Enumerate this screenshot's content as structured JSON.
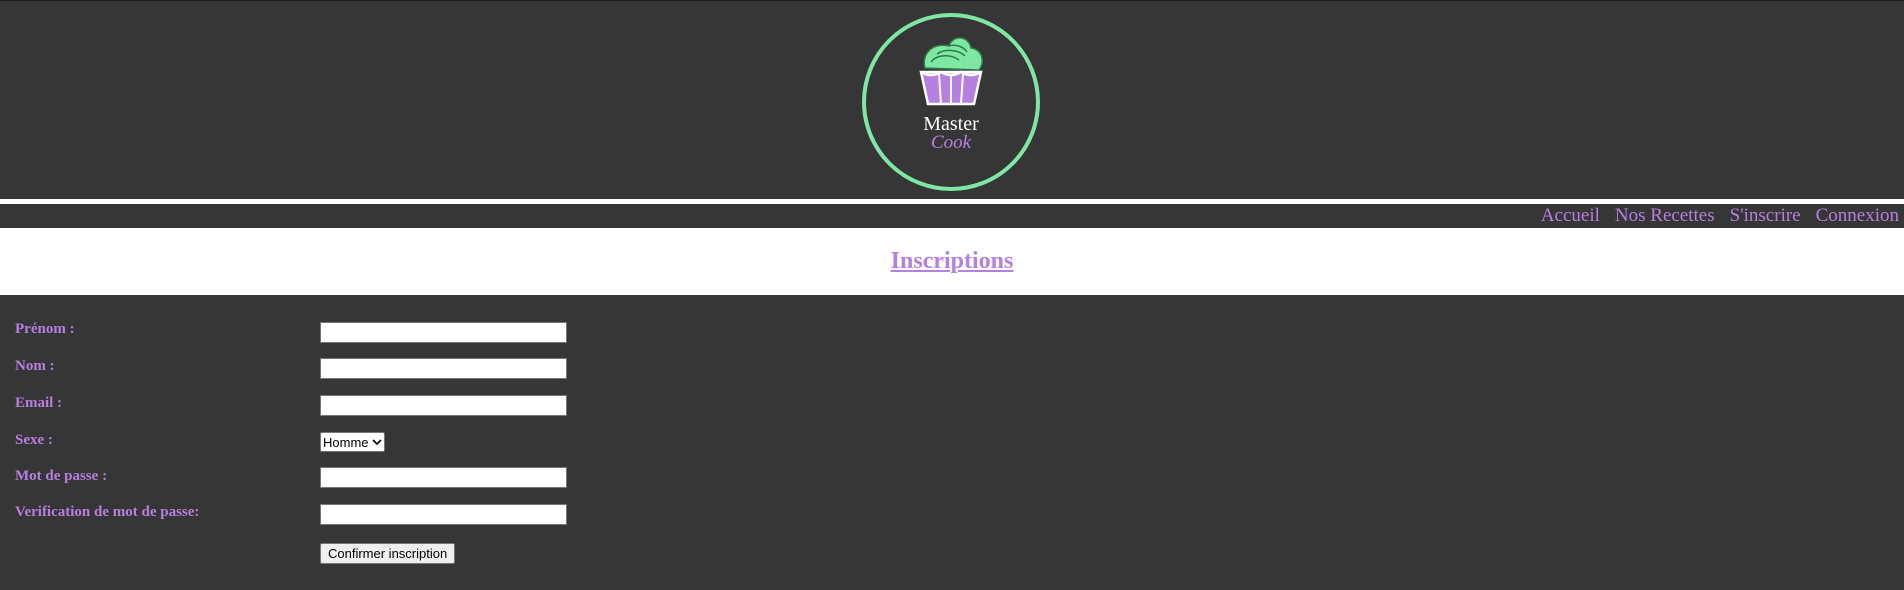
{
  "logo": {
    "line1": "Master",
    "line2": "Cook",
    "ring_color": "#7ee8a2",
    "accent_color": "#b77fe0"
  },
  "nav": {
    "items": [
      "Accueil",
      "Nos Recettes",
      "S'inscrire",
      "Connexion"
    ]
  },
  "page": {
    "title": "Inscriptions"
  },
  "form": {
    "firstname_label": "Prénom :",
    "lastname_label": "Nom :",
    "email_label": "Email :",
    "gender_label": "Sexe :",
    "gender_value": "Homme",
    "password_label": "Mot de passe :",
    "password_check_label": "Verification de mot de passe:",
    "submit_label": "Confirmer inscription"
  }
}
